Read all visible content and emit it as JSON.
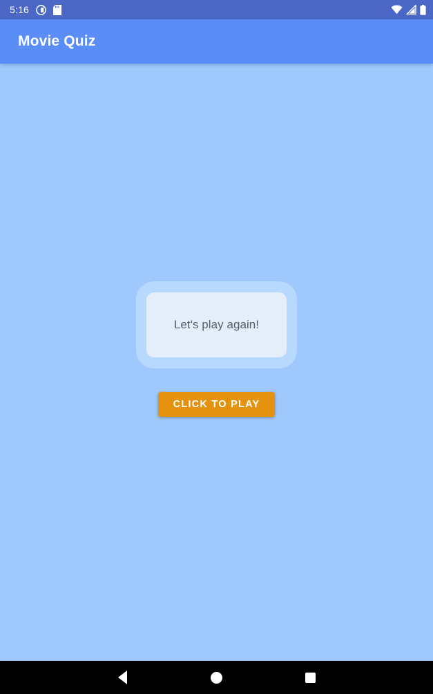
{
  "status_bar": {
    "clock": "5:16",
    "left_icons": [
      {
        "name": "do-not-disturb-icon"
      },
      {
        "name": "sd-card-icon"
      }
    ],
    "right_icons": [
      {
        "name": "wifi-icon"
      },
      {
        "name": "cellular-signal-icon"
      },
      {
        "name": "battery-icon"
      }
    ],
    "background_color": "#4b68c6"
  },
  "app_bar": {
    "title": "Movie Quiz",
    "background_color": "#5b8df6",
    "title_color": "#ffffff"
  },
  "screen": {
    "background_color": "#9fc9fc"
  },
  "quiz_card": {
    "question_text": "Let's play again!",
    "outer_color": "#b6d9fd",
    "inner_color": "#e4eefb",
    "text_color": "#585e66"
  },
  "play_button": {
    "label": "CLICK TO PLAY",
    "background_color": "#e5920e",
    "text_color": "#ffffff"
  },
  "nav_bar": {
    "background_color": "#000000",
    "buttons": [
      {
        "name": "back-button",
        "label": "Back"
      },
      {
        "name": "home-button",
        "label": "Home"
      },
      {
        "name": "recents-button",
        "label": "Recents"
      }
    ]
  }
}
